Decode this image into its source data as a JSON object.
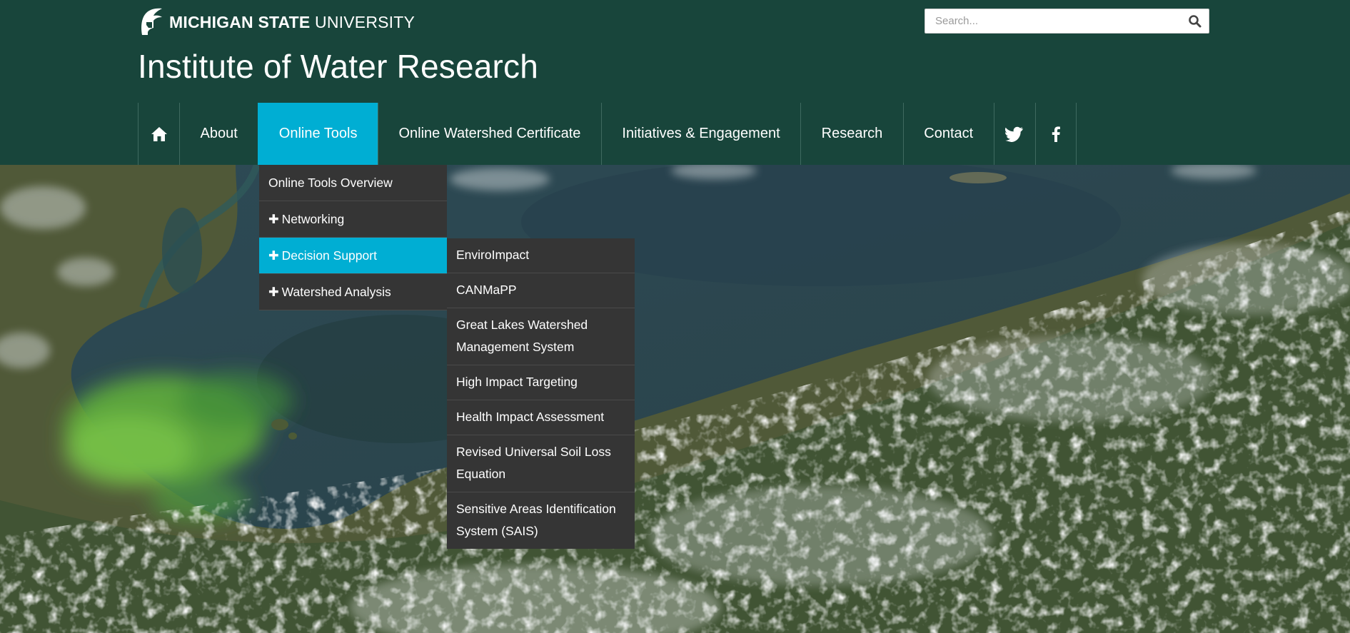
{
  "header": {
    "university_bold": "MICHIGAN STATE",
    "university_light": " UNIVERSITY",
    "site_title": "Institute of Water Research",
    "search": {
      "placeholder": "Search..."
    }
  },
  "nav": {
    "items": [
      {
        "label": "About"
      },
      {
        "label": "Online Tools"
      },
      {
        "label": "Online Watershed Certificate"
      },
      {
        "label": "Initiatives & Engagement"
      },
      {
        "label": "Research"
      },
      {
        "label": "Contact"
      }
    ]
  },
  "online_tools_menu": {
    "items": [
      {
        "label": "Online Tools Overview"
      },
      {
        "plus": "✚",
        "label": "Networking"
      },
      {
        "plus": "✚",
        "label": "Decision Support"
      },
      {
        "plus": "✚",
        "label": "Watershed Analysis"
      }
    ]
  },
  "decision_support_menu": {
    "items": [
      {
        "label": "EnviroImpact"
      },
      {
        "label": "CANMaPP"
      },
      {
        "label": "Great Lakes Watershed Management System"
      },
      {
        "label": "High Impact Targeting"
      },
      {
        "label": "Health Impact Assessment"
      },
      {
        "label": "Revised Universal Soil Loss Equation"
      },
      {
        "label": "Sensitive Areas Identification System (SAIS)"
      }
    ]
  },
  "colors": {
    "header_bg": "#18453b",
    "accent": "#00aed3",
    "menu_bg": "#353535"
  },
  "icons": [
    "spartan-helmet-icon",
    "search-icon",
    "home-icon",
    "twitter-icon",
    "facebook-icon"
  ]
}
